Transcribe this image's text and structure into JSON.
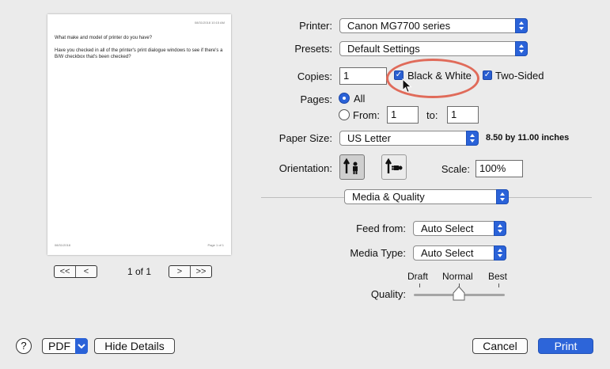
{
  "preview": {
    "header_text": "08/31/2018 10:15 AM",
    "question1": "What make and model of printer do you have?",
    "question2": "Have you checked in all of the printer's print dialogue windows to see if there's a B/W checkbox that's been checked?",
    "footer_left": "08/31/2018",
    "footer_right": "Page 1 of 1",
    "page_indicator": "1 of 1",
    "first_glyph": "<<",
    "prev_glyph": "<",
    "next_glyph": ">",
    "last_glyph": ">>"
  },
  "printer": {
    "label": "Printer:",
    "value": "Canon MG7700 series"
  },
  "presets": {
    "label": "Presets:",
    "value": "Default Settings"
  },
  "copies": {
    "label": "Copies:",
    "value": "1"
  },
  "black_white": {
    "label": "Black & White",
    "checked": true
  },
  "two_sided": {
    "label": "Two-Sided",
    "checked": true
  },
  "pages": {
    "label": "Pages:",
    "all_label": "All",
    "from_label": "From:",
    "from_value": "1",
    "to_label": "to:",
    "to_value": "1"
  },
  "paper_size": {
    "label": "Paper Size:",
    "value": "US Letter",
    "dimensions": "8.50 by 11.00 inches"
  },
  "orientation": {
    "label": "Orientation:",
    "selected": "portrait"
  },
  "scale": {
    "label": "Scale:",
    "value": "100%"
  },
  "section": {
    "value": "Media & Quality"
  },
  "feed_from": {
    "label": "Feed from:",
    "value": "Auto Select"
  },
  "media_type": {
    "label": "Media Type:",
    "value": "Auto Select"
  },
  "quality": {
    "label": "Quality:",
    "ticks": [
      "Draft",
      "Normal",
      "Best"
    ],
    "level": 0.5
  },
  "footer": {
    "help": "?",
    "pdf_label": "PDF",
    "hide_details_label": "Hide Details",
    "cancel_label": "Cancel",
    "print_label": "Print"
  },
  "colors": {
    "accent": "#2a62d8",
    "annotation": "#e06b5a"
  }
}
